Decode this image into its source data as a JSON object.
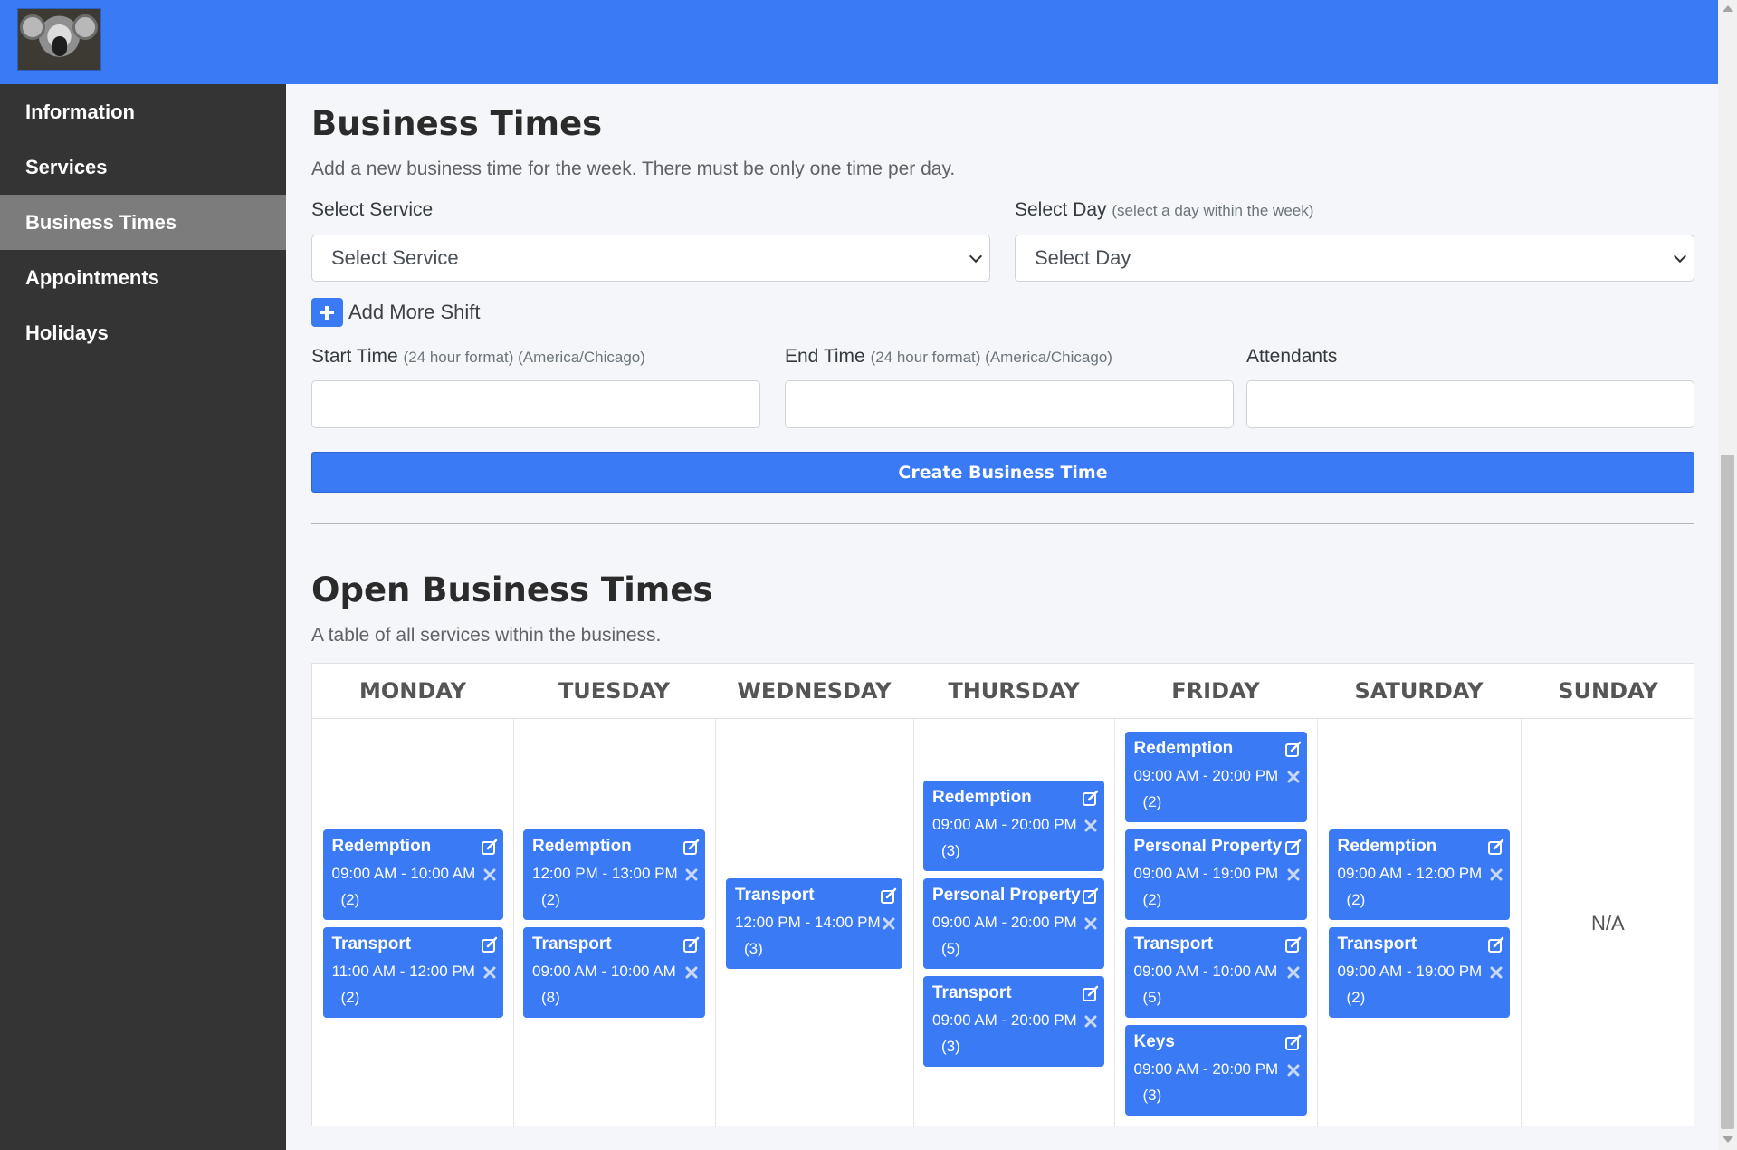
{
  "sidebar": {
    "items": [
      {
        "label": "Information"
      },
      {
        "label": "Services"
      },
      {
        "label": "Business Times"
      },
      {
        "label": "Appointments"
      },
      {
        "label": "Holidays"
      }
    ]
  },
  "form": {
    "title": "Business Times",
    "subtitle": "Add a new business time for the week. There must be only one time per day.",
    "service_label": "Select Service",
    "service_value": "Select Service",
    "day_label": "Select Day",
    "day_hint": "(select a day within the week)",
    "day_value": "Select Day",
    "add_shift_label": "Add More Shift",
    "start_label": "Start Time",
    "start_hint": "(24 hour format) (America/Chicago)",
    "end_label": "End Time",
    "end_hint": "(24 hour format) (America/Chicago)",
    "attendants_label": "Attendants",
    "create_button": "Create Business Time"
  },
  "open_times": {
    "title": "Open Business Times",
    "subtitle": "A table of all services within the business.",
    "days": [
      {
        "name": "MONDAY",
        "entries": [
          {
            "service": "Redemption",
            "time": "09:00 AM - 10:00 AM",
            "attendants": "(2)"
          },
          {
            "service": "Transport",
            "time": "11:00 AM - 12:00 PM",
            "attendants": "(2)"
          }
        ]
      },
      {
        "name": "TUESDAY",
        "entries": [
          {
            "service": "Redemption",
            "time": "12:00 PM - 13:00 PM",
            "attendants": "(2)"
          },
          {
            "service": "Transport",
            "time": "09:00 AM - 10:00 AM",
            "attendants": "(8)"
          }
        ]
      },
      {
        "name": "WEDNESDAY",
        "entries": [
          {
            "service": "Transport",
            "time": "12:00 PM - 14:00 PM",
            "attendants": "(3)"
          }
        ]
      },
      {
        "name": "THURSDAY",
        "entries": [
          {
            "service": "Redemption",
            "time": "09:00 AM - 20:00 PM",
            "attendants": "(3)"
          },
          {
            "service": "Personal Property",
            "time": "09:00 AM - 20:00 PM",
            "attendants": "(5)"
          },
          {
            "service": "Transport",
            "time": "09:00 AM - 20:00 PM",
            "attendants": "(3)"
          }
        ]
      },
      {
        "name": "FRIDAY",
        "entries": [
          {
            "service": "Redemption",
            "time": "09:00 AM - 20:00 PM",
            "attendants": "(2)"
          },
          {
            "service": "Personal Property",
            "time": "09:00 AM - 19:00 PM",
            "attendants": "(2)"
          },
          {
            "service": "Transport",
            "time": "09:00 AM - 10:00 AM",
            "attendants": "(5)"
          },
          {
            "service": "Keys",
            "time": "09:00 AM - 20:00 PM",
            "attendants": "(3)"
          }
        ]
      },
      {
        "name": "SATURDAY",
        "entries": [
          {
            "service": "Redemption",
            "time": "09:00 AM - 12:00 PM",
            "attendants": "(2)"
          },
          {
            "service": "Transport",
            "time": "09:00 AM - 19:00 PM",
            "attendants": "(2)"
          }
        ]
      },
      {
        "name": "SUNDAY",
        "entries": [],
        "empty_text": "N/A"
      }
    ]
  },
  "icons": {
    "logo": "koala-photo",
    "card_edit": "edit-icon",
    "card_delete": "close-icon",
    "add_shift": "plus-icon"
  },
  "colors": {
    "primary": "#3a7af5",
    "sidebar_bg": "#343434",
    "sidebar_active": "#7c7c7c"
  }
}
